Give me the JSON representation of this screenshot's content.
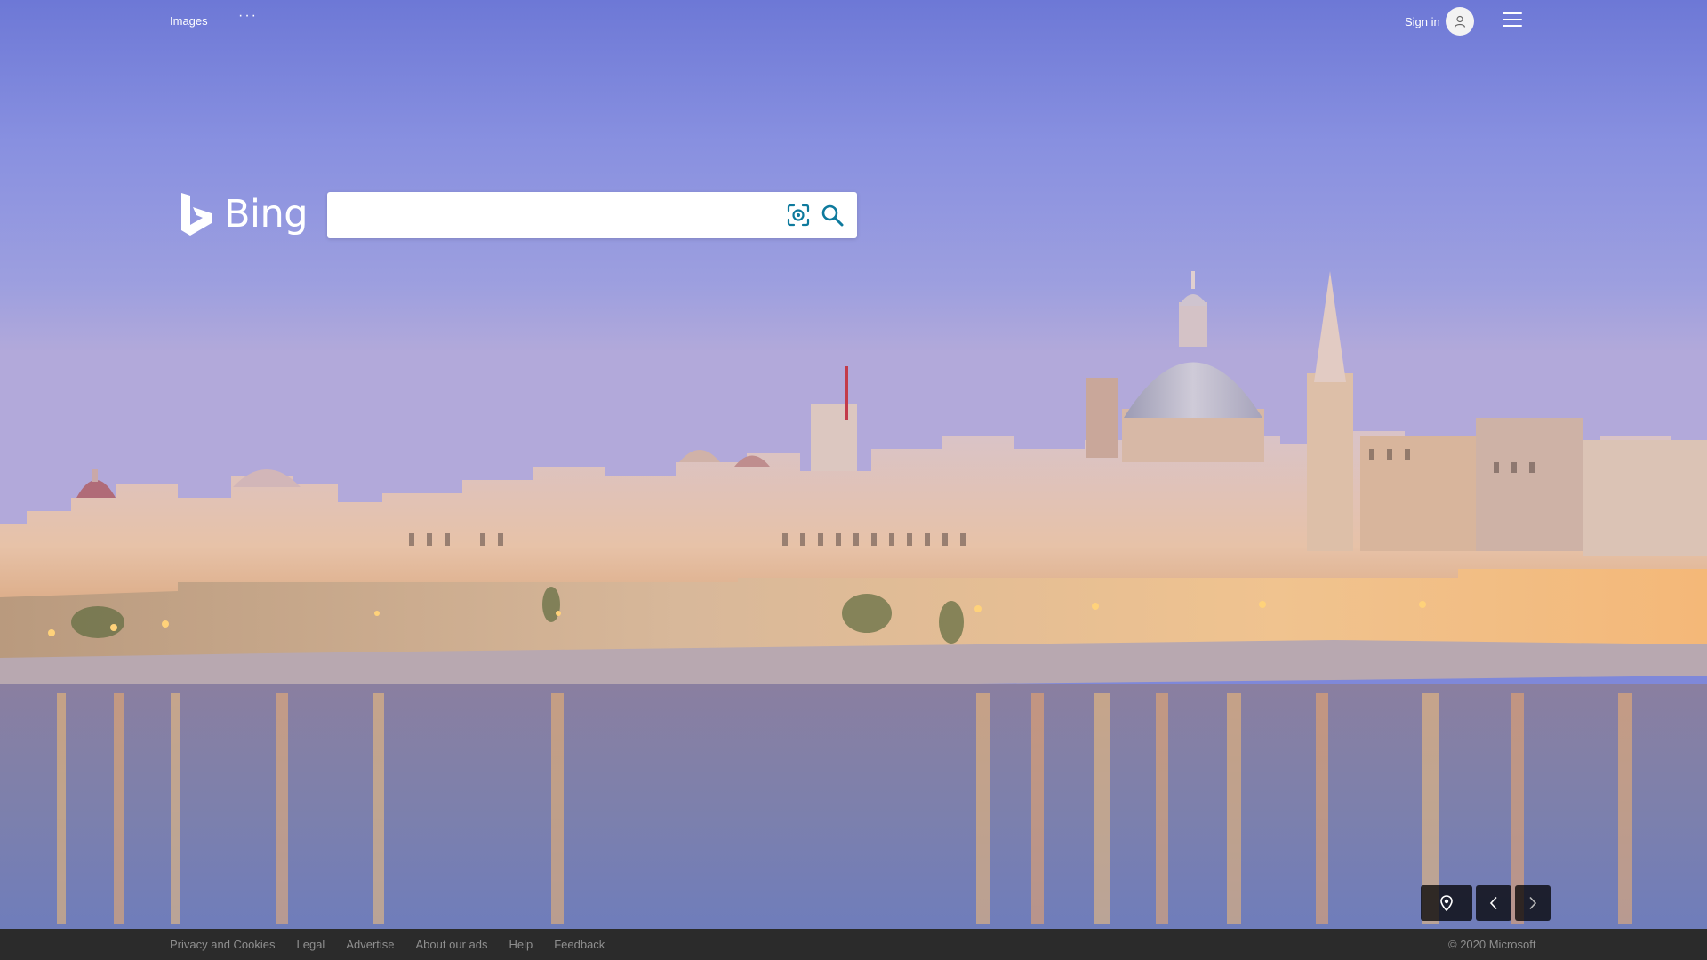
{
  "header": {
    "nav_items": [
      {
        "label": "Images"
      }
    ],
    "more_label": "···",
    "signin_label": "Sign in"
  },
  "brand": {
    "name": "Bing",
    "logo_color": "#ffffff"
  },
  "search": {
    "value": "",
    "placeholder": ""
  },
  "icons": {
    "visual_search": "visual-search-icon",
    "search": "search-icon",
    "location": "location-pin-icon",
    "prev": "chevron-left-icon",
    "next": "chevron-right-icon",
    "avatar": "user-icon",
    "menu": "hamburger-menu-icon"
  },
  "colors": {
    "accent": "#0e7a9d",
    "footer_bg": "#2b2b2b",
    "footer_text": "#8f8f8f"
  },
  "footer": {
    "links": [
      {
        "label": "Privacy and Cookies"
      },
      {
        "label": "Legal"
      },
      {
        "label": "Advertise"
      },
      {
        "label": "About our ads"
      },
      {
        "label": "Help"
      },
      {
        "label": "Feedback"
      }
    ],
    "copyright": "© 2020 Microsoft"
  }
}
